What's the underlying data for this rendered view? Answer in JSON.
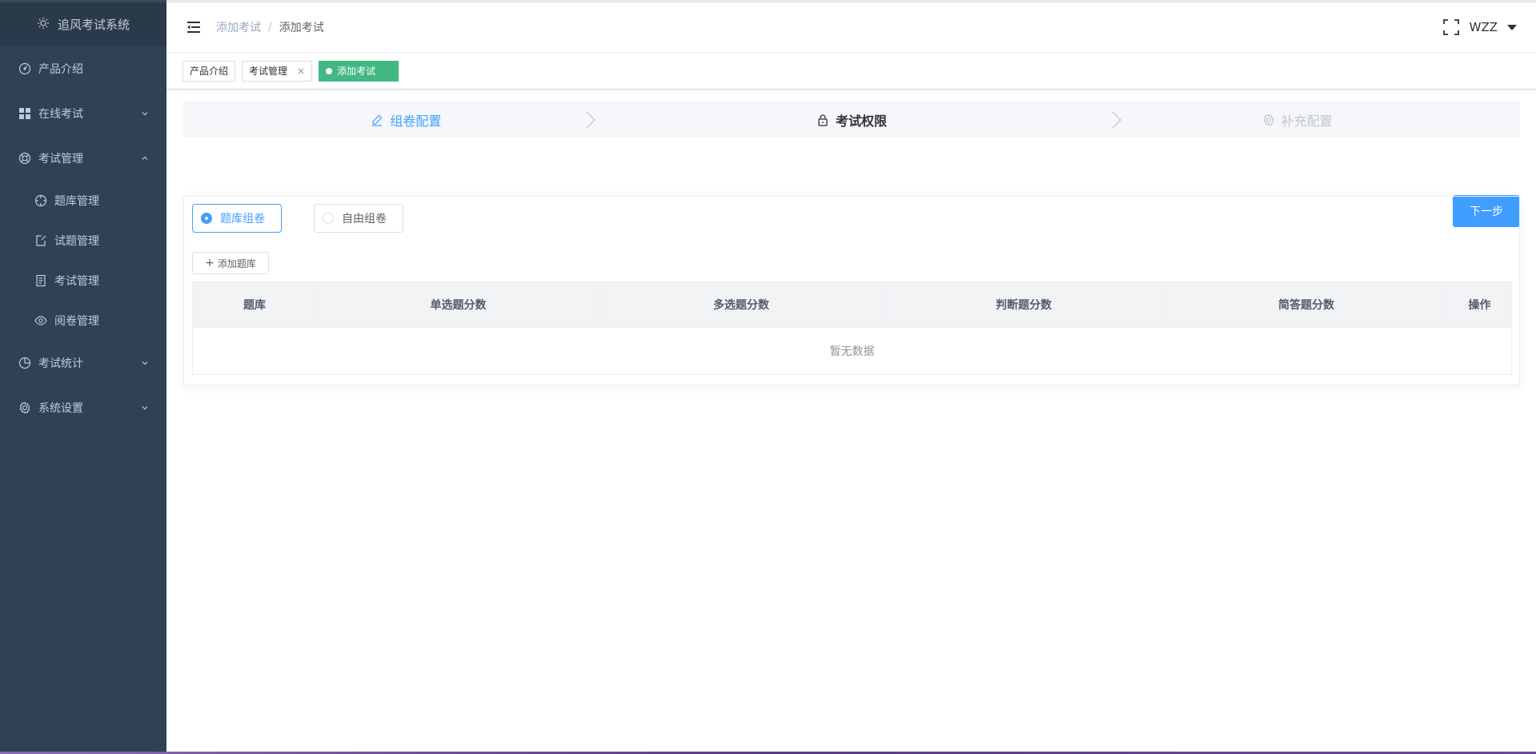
{
  "app": {
    "title": "追风考试系统",
    "logo_icon": "sun-icon"
  },
  "sidebar": {
    "items": [
      {
        "label": "产品介绍",
        "icon": "dashboard-icon",
        "expandable": false
      },
      {
        "label": "在线考试",
        "icon": "grid-icon",
        "expandable": true,
        "expanded": false
      },
      {
        "label": "考试管理",
        "icon": "lifebuoy-icon",
        "expandable": true,
        "expanded": true,
        "children": [
          {
            "label": "题库管理",
            "icon": "compass-icon"
          },
          {
            "label": "试题管理",
            "icon": "edit-square-icon"
          },
          {
            "label": "考试管理",
            "icon": "document-icon"
          },
          {
            "label": "阅卷管理",
            "icon": "eye-icon"
          }
        ]
      },
      {
        "label": "考试统计",
        "icon": "pie-chart-icon",
        "expandable": true,
        "expanded": false
      },
      {
        "label": "系统设置",
        "icon": "gear-icon",
        "expandable": true,
        "expanded": false
      }
    ]
  },
  "header": {
    "breadcrumb": [
      "添加考试",
      "添加考试"
    ],
    "username": "WZZ"
  },
  "tags": [
    {
      "label": "产品介绍",
      "closable": false,
      "active": false
    },
    {
      "label": "考试管理",
      "closable": true,
      "active": false
    },
    {
      "label": "添加考试",
      "closable": false,
      "active": true
    }
  ],
  "steps": [
    {
      "label": "组卷配置",
      "status": "done",
      "icon": "edit-icon"
    },
    {
      "label": "考试权限",
      "status": "active",
      "icon": "lock-icon"
    },
    {
      "label": "补充配置",
      "status": "wait",
      "icon": "gear-icon"
    }
  ],
  "next_button": "下一步",
  "mode": {
    "options": [
      "题库组卷",
      "自由组卷"
    ],
    "selected": "题库组卷"
  },
  "add_bank_button": "添加题库",
  "table": {
    "columns": [
      "题库",
      "单选题分数",
      "多选题分数",
      "判断题分数",
      "简答题分数",
      "操作"
    ],
    "rows": [],
    "empty_text": "暂无数据"
  },
  "colors": {
    "sidebar_bg": "#304156",
    "primary": "#409eff",
    "active_tag": "#42b983"
  }
}
